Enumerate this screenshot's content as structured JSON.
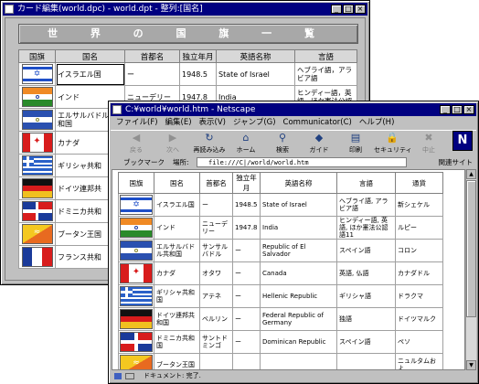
{
  "card_window": {
    "title": "カード編集(world.dpc) - world.dpt - 整列:[国名]",
    "banner": "世 界 の 国 旗 一 覧",
    "headers": [
      "国旗",
      "国名",
      "首都名",
      "独立年月",
      "英語名称",
      "言語"
    ],
    "rows": [
      {
        "flag": "israel",
        "name": "イスラエル国",
        "capital": "ー",
        "independence": "1948.5",
        "english": "State of Israel",
        "language": "ヘブライ語，アラビア語"
      },
      {
        "flag": "india",
        "name": "インド",
        "capital": "ニューデリー",
        "independence": "1947.8",
        "english": "India",
        "language": "ヒンディー語，英語，ほか憲法公認"
      },
      {
        "flag": "elsalvador",
        "name": "エルサルバドル共和国",
        "capital": "",
        "independence": "",
        "english": "",
        "language": ""
      },
      {
        "flag": "canada",
        "name": "カナダ",
        "capital": "",
        "independence": "",
        "english": "",
        "language": ""
      },
      {
        "flag": "greece",
        "name": "ギリシャ共和",
        "capital": "",
        "independence": "",
        "english": "",
        "language": ""
      },
      {
        "flag": "germany",
        "name": "ドイツ連邦共",
        "capital": "",
        "independence": "",
        "english": "",
        "language": ""
      },
      {
        "flag": "dominican",
        "name": "ドミニカ共和",
        "capital": "",
        "independence": "",
        "english": "",
        "language": ""
      },
      {
        "flag": "bhutan",
        "name": "ブータン王国",
        "capital": "",
        "independence": "",
        "english": "",
        "language": ""
      },
      {
        "flag": "france",
        "name": "フランス共和",
        "capital": "",
        "independence": "",
        "english": "",
        "language": ""
      }
    ]
  },
  "ns_window": {
    "title": "C:¥world¥world.htm - Netscape",
    "menu": [
      "ファイル(F)",
      "編集(E)",
      "表示(V)",
      "ジャンプ(G)",
      "Communicator(C)",
      "ヘルプ(H)"
    ],
    "toolbar": [
      {
        "label": "戻る",
        "icon": "back-arrow-icon",
        "glyph": "◀",
        "disabled": true
      },
      {
        "label": "次へ",
        "icon": "forward-arrow-icon",
        "glyph": "▶",
        "disabled": true
      },
      {
        "label": "再読み込み",
        "icon": "reload-icon",
        "glyph": "↻",
        "disabled": false
      },
      {
        "label": "ホーム",
        "icon": "home-icon",
        "glyph": "⌂",
        "disabled": false
      },
      {
        "label": "検索",
        "icon": "search-icon",
        "glyph": "⚲",
        "disabled": false
      },
      {
        "label": "ガイド",
        "icon": "guide-icon",
        "glyph": "◆",
        "disabled": false
      },
      {
        "label": "印刷",
        "icon": "print-icon",
        "glyph": "▤",
        "disabled": false
      },
      {
        "label": "セキュリティ",
        "icon": "lock-icon",
        "glyph": "🔒",
        "disabled": false
      },
      {
        "label": "中止",
        "icon": "stop-icon",
        "glyph": "✖",
        "disabled": true
      }
    ],
    "logo": "N",
    "bookmarks_label": "ブックマーク",
    "location_label": "場所:",
    "location_value": "file:///C|/world/world.htm",
    "related_label": "関連サイト",
    "status_text": "ドキュメント: 完了.",
    "headers": [
      "国旗",
      "国名",
      "首都名",
      "独立年月",
      "英語名称",
      "言語",
      "通貨"
    ],
    "rows": [
      {
        "flag": "israel",
        "name": "イスラエル国",
        "capital": "ー",
        "independence": "1948.5",
        "english": "State of Israel",
        "language": "ヘブライ語, アラビア語",
        "currency": "新シェケル"
      },
      {
        "flag": "india",
        "name": "インド",
        "capital": "ニューデリー",
        "independence": "1947.8",
        "english": "India",
        "language": "ヒンディー語, 英語, ほか憲法公認語11",
        "currency": "ルピー"
      },
      {
        "flag": "elsalvador",
        "name": "エルサルバドル共和国",
        "capital": "サンサルバドル",
        "independence": "ー",
        "english": "Republic of El Salvador",
        "language": "スペイン語",
        "currency": "コロン"
      },
      {
        "flag": "canada",
        "name": "カナダ",
        "capital": "オタワ",
        "independence": "ー",
        "english": "Canada",
        "language": "英語, 仏語",
        "currency": "カナダドル"
      },
      {
        "flag": "greece",
        "name": "ギリシャ共和国",
        "capital": "アテネ",
        "independence": "ー",
        "english": "Hellenic Republic",
        "language": "ギリシャ語",
        "currency": "ドラクマ"
      },
      {
        "flag": "germany",
        "name": "ドイツ連邦共和国",
        "capital": "ベルリン",
        "independence": "ー",
        "english": "Federal Republic of Germany",
        "language": "独語",
        "currency": "ドイツマルク"
      },
      {
        "flag": "dominican",
        "name": "ドミニカ共和国",
        "capital": "サントドミンゴ",
        "independence": "ー",
        "english": "Dominican Republic",
        "language": "スペイン語",
        "currency": "ペソ"
      },
      {
        "flag": "bhutan",
        "name": "ブータン王国",
        "capital": "",
        "independence": "",
        "english": "",
        "language": "",
        "currency": "ニュルタムおよ"
      }
    ]
  }
}
